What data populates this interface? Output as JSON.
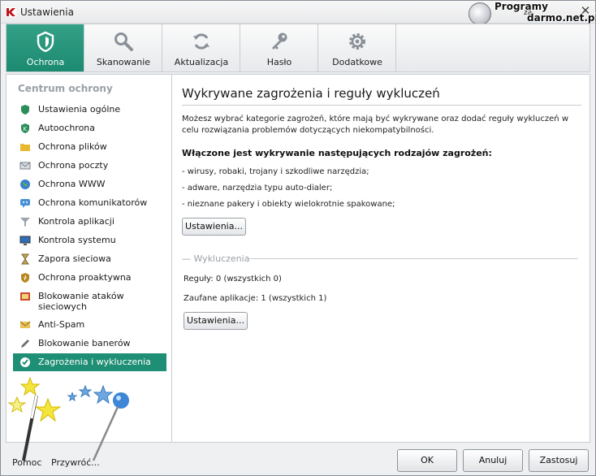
{
  "window": {
    "title": "Ustawienia"
  },
  "watermark": {
    "line1": "Programy",
    "za": "za",
    "line2": "darmo.net.pl"
  },
  "tabs": [
    {
      "label": "Ochrona",
      "icon": "shield-icon",
      "active": true
    },
    {
      "label": "Skanowanie",
      "icon": "magnifier-icon"
    },
    {
      "label": "Aktualizacja",
      "icon": "refresh-icon"
    },
    {
      "label": "Hasło",
      "icon": "key-icon"
    },
    {
      "label": "Dodatkowe",
      "icon": "gear-icon"
    }
  ],
  "sidebar": {
    "header": "Centrum ochrony",
    "items": [
      {
        "label": "Ustawienia ogólne",
        "icon": "shield-icon"
      },
      {
        "label": "Autoochrona",
        "icon": "k-shield-icon"
      },
      {
        "label": "Ochrona plików",
        "icon": "folder-icon"
      },
      {
        "label": "Ochrona poczty",
        "icon": "envelope-icon"
      },
      {
        "label": "Ochrona WWW",
        "icon": "globe-icon"
      },
      {
        "label": "Ochrona komunikatorów",
        "icon": "chat-icon"
      },
      {
        "label": "Kontrola aplikacji",
        "icon": "filter-icon"
      },
      {
        "label": "Kontrola systemu",
        "icon": "monitor-icon"
      },
      {
        "label": "Zapora sieciowa",
        "icon": "hourglass-icon"
      },
      {
        "label": "Ochrona proaktywna",
        "icon": "proactive-shield-icon"
      },
      {
        "label": "Blokowanie ataków sieciowych",
        "icon": "attack-block-icon"
      },
      {
        "label": "Anti-Spam",
        "icon": "spam-icon"
      },
      {
        "label": "Blokowanie banerów",
        "icon": "pencil-icon"
      },
      {
        "label": "Zagrożenia i wykluczenia",
        "icon": "check-circle-icon",
        "selected": true
      }
    ]
  },
  "main": {
    "title": "Wykrywane zagrożenia i reguły wykluczeń",
    "description": "Możesz wybrać kategorie zagrożeń, które mają być wykrywane oraz dodać reguły wykluczeń w celu rozwiązania problemów dotyczących niekompatybilności.",
    "enabled_heading": "Włączone jest wykrywanie następujących rodzajów zagrożeń:",
    "threats": [
      "- wirusy, robaki, trojany i szkodliwe narzędzia;",
      "- adware, narzędzia typu auto-dialer;",
      "- nieznane pakery i obiekty wielokrotnie spakowane;"
    ],
    "settings_button_1": "Ustawienia...",
    "exclusions_legend": "— Wykluczenia",
    "rules": "Reguły: 0 (wszystkich 0)",
    "trusted_apps": "Zaufane aplikacje: 1 (wszystkich 1)",
    "settings_button_2": "Ustawienia..."
  },
  "footer": {
    "help": "Pomoc",
    "restore": "Przywróć...",
    "ok": "OK",
    "cancel": "Anuluj",
    "apply": "Zastosuj"
  },
  "colors": {
    "accent": "#1e8f74",
    "tab_active": "#2a977c"
  }
}
